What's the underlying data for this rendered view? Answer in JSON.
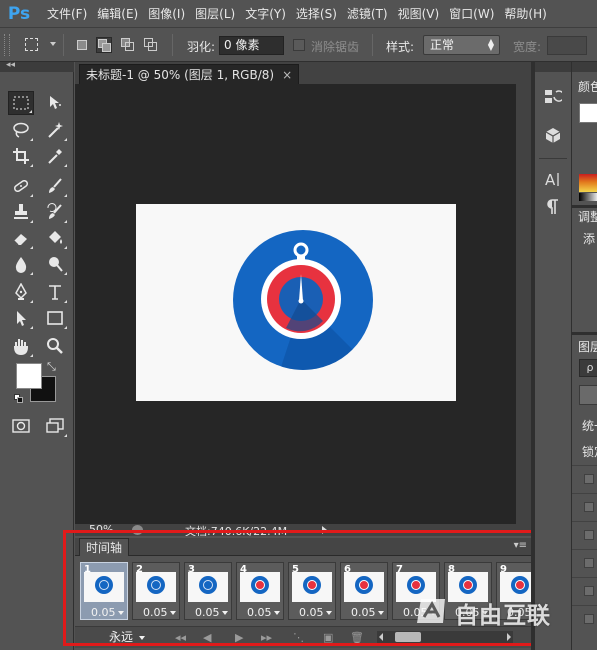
{
  "app": {
    "logo": "Ps",
    "menu": [
      "文件(F)",
      "编辑(E)",
      "图像(I)",
      "图层(L)",
      "文字(Y)",
      "选择(S)",
      "滤镜(T)",
      "视图(V)",
      "窗口(W)",
      "帮助(H)"
    ]
  },
  "options": {
    "feather_label": "羽化:",
    "feather_value": "0 像素",
    "antialias_label": "消除锯齿",
    "style_label": "样式:",
    "style_value": "正常",
    "width_label": "宽度:"
  },
  "tools": {
    "rows": [
      [
        "rect-marquee-icon",
        "move-icon"
      ],
      [
        "lasso-icon",
        "magic-wand-icon"
      ],
      [
        "crop-icon",
        "eyedropper-icon"
      ],
      [
        "healing-brush-icon",
        "brush-icon"
      ],
      [
        "clone-stamp-icon",
        "history-brush-icon"
      ],
      [
        "eraser-icon",
        "paint-bucket-icon"
      ],
      [
        "blur-icon",
        "dodge-icon"
      ],
      [
        "pen-icon",
        "type-icon"
      ],
      [
        "path-selection-icon",
        "rectangle-shape-icon"
      ],
      [
        "hand-icon",
        "zoom-icon"
      ]
    ],
    "foreground_color": "#ffffff",
    "background_color": "#111111"
  },
  "document": {
    "tab_title": "未标题-1 @ 50% (图层 1, RGB/8)",
    "close_glyph": "×",
    "zoom": "50%",
    "info": "文档:740.6K/22.4M"
  },
  "timeline": {
    "tab_label": "时间轴",
    "frames": [
      {
        "num": "1",
        "delay": "0.05",
        "variant": "plain"
      },
      {
        "num": "2",
        "delay": "0.05",
        "variant": "plain"
      },
      {
        "num": "3",
        "delay": "0.05",
        "variant": "plain"
      },
      {
        "num": "4",
        "delay": "0.05",
        "variant": "red"
      },
      {
        "num": "5",
        "delay": "0.05",
        "variant": "red"
      },
      {
        "num": "6",
        "delay": "0.05",
        "variant": "red"
      },
      {
        "num": "7",
        "delay": "0.05",
        "variant": "red"
      },
      {
        "num": "8",
        "delay": "0.05",
        "variant": "red"
      },
      {
        "num": "9",
        "delay": "0.05",
        "variant": "red"
      }
    ],
    "loop_label": "永远"
  },
  "right_panel": {
    "color_tab": "颜色",
    "adjust_tab": "调整",
    "add_label": "添",
    "layers_tab": "图层",
    "search_glyph": "ρ",
    "unify_label": "统一",
    "lock_label": "锁定"
  },
  "watermark": {
    "text": "自由互联"
  },
  "colors": {
    "accent_blue": "#1466c2",
    "accent_red": "#e7323f",
    "highlight_box": "#e11a1a",
    "ps_blue": "#3ea4f0"
  }
}
